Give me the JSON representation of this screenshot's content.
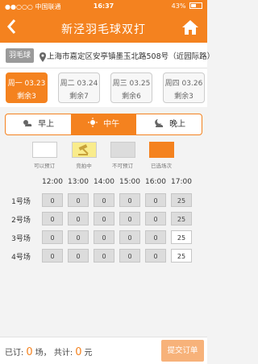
{
  "status_bar": {
    "carrier": "●●○○○ 中国联通",
    "time": "16:37",
    "battery": "43%"
  },
  "nav": {
    "title": "新泾羽毛球双打",
    "back_icon": "chevron-left-icon",
    "home_icon": "home-icon"
  },
  "venue": {
    "tag": "羽毛球",
    "address": "上海市嘉定区安亭镇墨玉北路508号（近园际路）"
  },
  "dates": [
    {
      "day": "周一 03.23",
      "remaining": "剩余3",
      "active": true
    },
    {
      "day": "周二 03.24",
      "remaining": "剩余7",
      "active": false
    },
    {
      "day": "周三 03.25",
      "remaining": "剩余6",
      "active": false
    },
    {
      "day": "周四 03.26",
      "remaining": "剩余3",
      "active": false
    }
  ],
  "periods": [
    {
      "label": "早上",
      "icon": "cloud-sun-icon",
      "active": false
    },
    {
      "label": "中午",
      "icon": "sun-icon",
      "active": true
    },
    {
      "label": "晚上",
      "icon": "cloud-moon-icon",
      "active": false
    }
  ],
  "legend": [
    {
      "label": "可以预订",
      "color": "#ffffff"
    },
    {
      "label": "竞拍中",
      "color": "#f9ec8c"
    },
    {
      "label": "不可预订",
      "color": "#dcdcdc"
    },
    {
      "label": "已选场次",
      "color": "#f4821f"
    }
  ],
  "times": [
    "12:00",
    "13:00",
    "14:00",
    "15:00",
    "16:00",
    "17:00"
  ],
  "courts": [
    {
      "name": "1号场",
      "cells": [
        {
          "v": "0",
          "s": "unavailable"
        },
        {
          "v": "0",
          "s": "unavailable"
        },
        {
          "v": "0",
          "s": "unavailable"
        },
        {
          "v": "0",
          "s": "unavailable"
        },
        {
          "v": "0",
          "s": "unavailable"
        },
        {
          "v": "25",
          "s": "unavailable"
        }
      ]
    },
    {
      "name": "2号场",
      "cells": [
        {
          "v": "0",
          "s": "unavailable"
        },
        {
          "v": "0",
          "s": "unavailable"
        },
        {
          "v": "0",
          "s": "unavailable"
        },
        {
          "v": "0",
          "s": "unavailable"
        },
        {
          "v": "0",
          "s": "unavailable"
        },
        {
          "v": "25",
          "s": "unavailable"
        }
      ]
    },
    {
      "name": "3号场",
      "cells": [
        {
          "v": "0",
          "s": "unavailable"
        },
        {
          "v": "0",
          "s": "unavailable"
        },
        {
          "v": "0",
          "s": "unavailable"
        },
        {
          "v": "0",
          "s": "unavailable"
        },
        {
          "v": "0",
          "s": "unavailable"
        },
        {
          "v": "25",
          "s": "available"
        }
      ]
    },
    {
      "name": "4号场",
      "cells": [
        {
          "v": "0",
          "s": "unavailable"
        },
        {
          "v": "0",
          "s": "unavailable"
        },
        {
          "v": "0",
          "s": "unavailable"
        },
        {
          "v": "0",
          "s": "unavailable"
        },
        {
          "v": "0",
          "s": "unavailable"
        },
        {
          "v": "25",
          "s": "available"
        }
      ]
    }
  ],
  "bottom": {
    "booked_prefix": "已订:",
    "booked_count": "0",
    "booked_unit": "场，",
    "total_prefix": "共计:",
    "total_amount": "0",
    "currency": "元",
    "submit_label": "提交订单"
  }
}
